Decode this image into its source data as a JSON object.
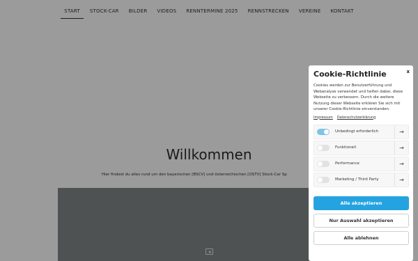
{
  "nav": {
    "items": [
      {
        "label": "START",
        "active": true
      },
      {
        "label": "STOCK-CAR"
      },
      {
        "label": "BILDER"
      },
      {
        "label": "VIDEOS"
      },
      {
        "label": "RENNTERMINE 2025"
      },
      {
        "label": "RENNSTRECKEN"
      },
      {
        "label": "VEREINE"
      },
      {
        "label": "KONTAKT"
      }
    ]
  },
  "hero": {
    "title": "Willkommen",
    "subtitle": "Hier findest du alles rund um den bayerischen [BSCV] und österreichischen [ÖSTV] Stock-Car Sp"
  },
  "video": {
    "icon": "play-icon"
  },
  "cookie": {
    "close": "x",
    "title": "Cookie-Richtlinie",
    "text": "Cookies werden zur Benutzerführung und Webanalyse verwendet und helfen dabei, diese Webseite zu verbessern. Durch die weitere Nutzung dieser Webseite erklären Sie sich mit unserer Cookie-Richtlinie einverstanden.",
    "link_impressum": "Impressum",
    "link_privacy": "Datenschutzerklärung",
    "categories": [
      {
        "label": "Unbedingt erforderlich",
        "enabled": true
      },
      {
        "label": "Funktionell",
        "enabled": false
      },
      {
        "label": "Performance",
        "enabled": false
      },
      {
        "label": "Marketing / Third Party",
        "enabled": false
      }
    ],
    "arrow": "→",
    "btn_accept_all": "Alle akzeptieren",
    "btn_accept_selection": "Nur Auswahl akzeptieren",
    "btn_reject_all": "Alle ablehnen"
  },
  "colors": {
    "overlay": "#9b9b9b",
    "accent": "#25a3e0",
    "toggle_on": "#7fc3e6"
  }
}
